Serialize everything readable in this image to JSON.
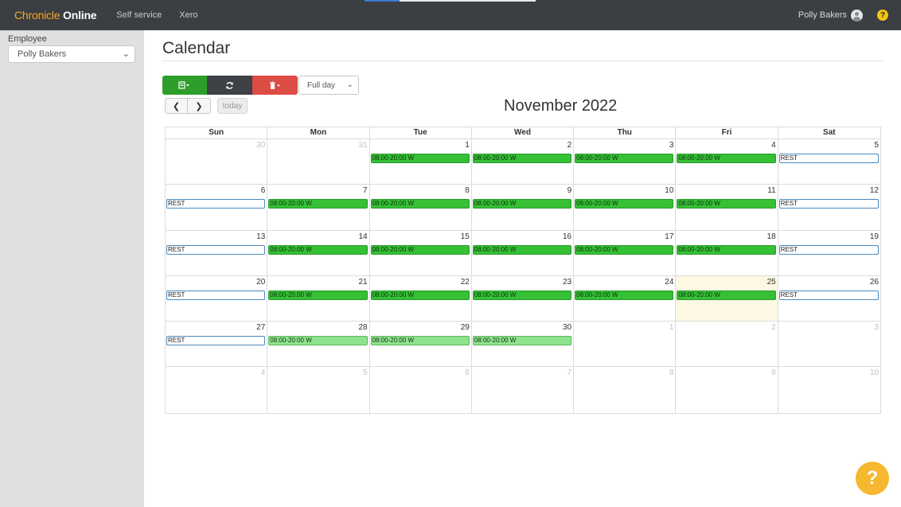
{
  "topbar": {
    "brand_part1": "Chronicle",
    "brand_part2": " Online",
    "nav": [
      "Self service",
      "Xero"
    ],
    "user_name": "Polly Bakers",
    "help": "?"
  },
  "sidebar": {
    "label": "Employee",
    "selected": "Polly Bakers"
  },
  "main": {
    "title": "Calendar",
    "view_select": "Full day",
    "today_label": "today",
    "month_title": "November 2022"
  },
  "calendar": {
    "weekdays": [
      "Sun",
      "Mon",
      "Tue",
      "Wed",
      "Thu",
      "Fri",
      "Sat"
    ],
    "weeks": [
      [
        {
          "day": "30",
          "other": true,
          "event": null
        },
        {
          "day": "31",
          "other": true,
          "event": null
        },
        {
          "day": "1",
          "event": "08:00-20:00 W",
          "type": "work"
        },
        {
          "day": "2",
          "event": "08:00-20:00 W",
          "type": "work"
        },
        {
          "day": "3",
          "event": "08:00-20:00 W",
          "type": "work"
        },
        {
          "day": "4",
          "event": "08:00-20:00 W",
          "type": "work"
        },
        {
          "day": "5",
          "event": "REST",
          "type": "rest"
        }
      ],
      [
        {
          "day": "6",
          "event": "REST",
          "type": "rest"
        },
        {
          "day": "7",
          "event": "08:00-20:00 W",
          "type": "work"
        },
        {
          "day": "8",
          "event": "08:00-20:00 W",
          "type": "work"
        },
        {
          "day": "9",
          "event": "08:00-20:00 W",
          "type": "work"
        },
        {
          "day": "10",
          "event": "08:00-20:00 W",
          "type": "work"
        },
        {
          "day": "11",
          "event": "08:00-20:00 W",
          "type": "work"
        },
        {
          "day": "12",
          "event": "REST",
          "type": "rest"
        }
      ],
      [
        {
          "day": "13",
          "event": "REST",
          "type": "rest"
        },
        {
          "day": "14",
          "event": "08:00-20:00 W",
          "type": "work"
        },
        {
          "day": "15",
          "event": "08:00-20:00 W",
          "type": "work"
        },
        {
          "day": "16",
          "event": "08:00-20:00 W",
          "type": "work"
        },
        {
          "day": "17",
          "event": "08:00-20:00 W",
          "type": "work"
        },
        {
          "day": "18",
          "event": "08:00-20:00 W",
          "type": "work"
        },
        {
          "day": "19",
          "event": "REST",
          "type": "rest"
        }
      ],
      [
        {
          "day": "20",
          "event": "REST",
          "type": "rest"
        },
        {
          "day": "21",
          "event": "08:00-20:00 W",
          "type": "work"
        },
        {
          "day": "22",
          "event": "08:00-20:00 W",
          "type": "work"
        },
        {
          "day": "23",
          "event": "08:00-20:00 W",
          "type": "work"
        },
        {
          "day": "24",
          "event": "08:00-20:00 W",
          "type": "work"
        },
        {
          "day": "25",
          "today": true,
          "event": "08:00-20:00 W",
          "type": "work"
        },
        {
          "day": "26",
          "event": "REST",
          "type": "rest"
        }
      ],
      [
        {
          "day": "27",
          "event": "REST",
          "type": "rest"
        },
        {
          "day": "28",
          "event": "08:00-20:00 W",
          "type": "work-light"
        },
        {
          "day": "29",
          "event": "08:00-20:00 W",
          "type": "work-light"
        },
        {
          "day": "30",
          "event": "08:00-20:00 W",
          "type": "work-light"
        },
        {
          "day": "1",
          "other": true,
          "event": null
        },
        {
          "day": "2",
          "other": true,
          "event": null
        },
        {
          "day": "3",
          "other": true,
          "event": null
        }
      ],
      [
        {
          "day": "4",
          "other": true,
          "event": null
        },
        {
          "day": "5",
          "other": true,
          "event": null
        },
        {
          "day": "6",
          "other": true,
          "event": null
        },
        {
          "day": "7",
          "other": true,
          "event": null
        },
        {
          "day": "8",
          "other": true,
          "event": null
        },
        {
          "day": "9",
          "other": true,
          "event": null
        },
        {
          "day": "10",
          "other": true,
          "event": null
        }
      ]
    ]
  },
  "colors": {
    "topbar": "#3b3e42",
    "brand_accent": "#f5a623",
    "work_event": "#35c035",
    "work_event_light": "#8fe38f",
    "rest_border": "#4a8ac0",
    "today_cell": "#fcf8e3",
    "help_button": "#f5b82e"
  },
  "icons": {
    "add_menu": "list-add-icon",
    "refresh": "refresh-icon",
    "delete_menu": "trash-icon",
    "prev": "chevron-left-icon",
    "next": "chevron-right-icon",
    "user": "user-avatar-icon",
    "help": "help-icon"
  }
}
